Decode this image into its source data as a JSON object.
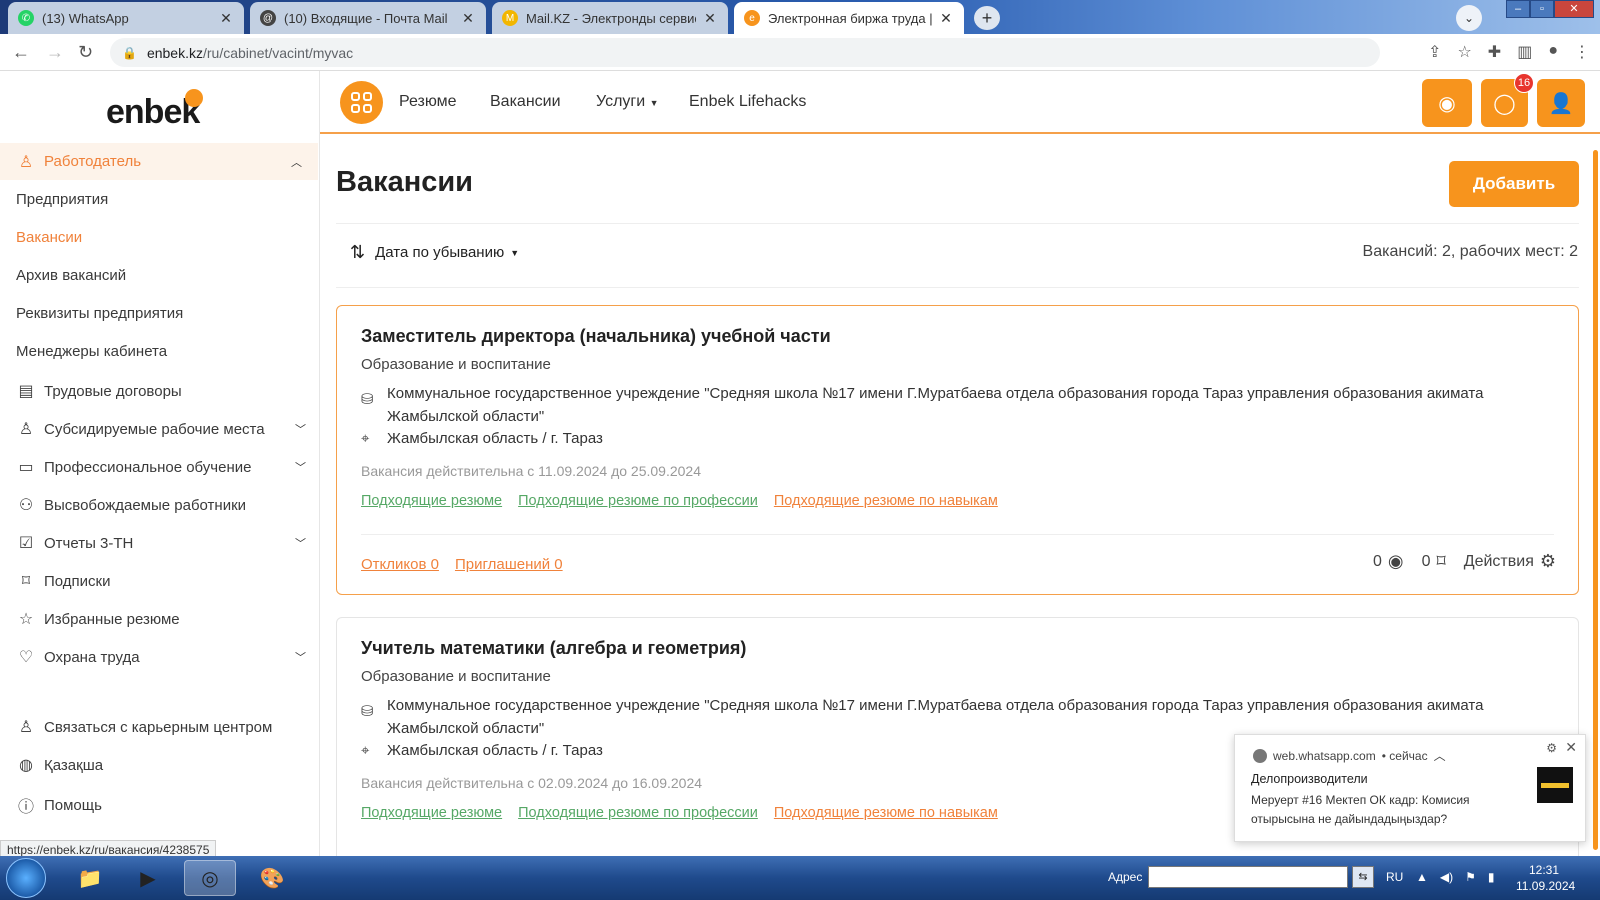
{
  "browser": {
    "tabs": [
      {
        "label": "(13) WhatsApp",
        "active": false,
        "icon": "whatsapp-icon",
        "color": "#25d366"
      },
      {
        "label": "(10) Входящие - Почта Mail",
        "active": false,
        "icon": "mail-icon",
        "color": "#444444"
      },
      {
        "label": "Mail.KZ - Электронды сервиске",
        "active": false,
        "icon": "mailkz-icon",
        "color": "#f2b600"
      },
      {
        "label": "Электронная биржа труда | Вак",
        "active": true,
        "icon": "enbek-icon",
        "color": "#f7941d"
      }
    ],
    "url_domain": "enbek.kz",
    "url_path": "/ru/cabinet/vacint/myvac",
    "status_url": "https://enbek.kz/ru/вакансия/4238575"
  },
  "logo_text": "enbek",
  "sidebar": {
    "section_label": "Работодатель",
    "items": [
      {
        "label": "Предприятия",
        "icon": "",
        "active": false,
        "chevron": false
      },
      {
        "label": "Вакансии",
        "icon": "",
        "active": true,
        "chevron": false
      },
      {
        "label": "Архив вакансий",
        "icon": "",
        "active": false,
        "chevron": false
      },
      {
        "label": "Реквизиты предприятия",
        "icon": "",
        "active": false,
        "chevron": false
      },
      {
        "label": "Менеджеры кабинета",
        "icon": "",
        "active": false,
        "chevron": false
      },
      {
        "label": "Трудовые договоры",
        "icon": "document-icon",
        "active": false,
        "chevron": false
      },
      {
        "label": "Субсидируемые рабочие места",
        "icon": "user-settings-icon",
        "active": false,
        "chevron": true
      },
      {
        "label": "Профессиональное обучение",
        "icon": "book-icon",
        "active": false,
        "chevron": true
      },
      {
        "label": "Высвобождаемые работники",
        "icon": "users-icon",
        "active": false,
        "chevron": false
      },
      {
        "label": "Отчеты 3-ТН",
        "icon": "checkbox-icon",
        "active": false,
        "chevron": true
      },
      {
        "label": "Подписки",
        "icon": "bookmark-icon",
        "active": false,
        "chevron": false
      },
      {
        "label": "Избранные резюме",
        "icon": "star-icon",
        "active": false,
        "chevron": false
      },
      {
        "label": "Охрана труда",
        "icon": "heart-icon",
        "active": false,
        "chevron": true
      }
    ],
    "bottom_items": [
      {
        "label": "Связаться с карьерным центром",
        "icon": "contact-icon"
      },
      {
        "label": "Қазақша",
        "icon": "globe-icon"
      },
      {
        "label": "Помощь",
        "icon": "help-icon"
      }
    ]
  },
  "header": {
    "nav": [
      "Резюме",
      "Вакансии",
      "Услуги",
      "Enbek Lifehacks"
    ],
    "messages_badge": "16"
  },
  "main": {
    "title": "Вакансии",
    "add_button": "Добавить",
    "sort_label": "Дата по убыванию",
    "count_text": "Вакансий: 2, рабочих мест: 2",
    "vacancies": [
      {
        "title": "Заместитель директора (начальника) учебной части",
        "category": "Образование и воспитание",
        "org": "Коммунальное государственное учреждение \"Средняя школа №17 имени Г.Муратбаева отдела образования города Тараз управления образования акимата Жамбылской области\"",
        "location": "Жамбылская область / г. Тараз",
        "validity": "Вакансия действительна с 11.09.2024 до 25.09.2024",
        "link1": "Подходящие резюме",
        "link2": "Подходящие резюме по профессии",
        "link3": "Подходящие резюме по навыкам",
        "responses": "Откликов 0",
        "invitations": "Приглашений 0",
        "views": "0",
        "saved": "0",
        "actions": "Действия"
      },
      {
        "title": "Учитель математики (алгебра и геометрия)",
        "category": "Образование и воспитание",
        "org": "Коммунальное государственное учреждение \"Средняя школа №17 имени Г.Муратбаева отдела образования города Тараз управления образования акимата Жамбылской области\"",
        "location": "Жамбылская область / г. Тараз",
        "validity": "Вакансия действительна с 02.09.2024 до 16.09.2024",
        "link1": "Подходящие резюме",
        "link2": "Подходящие резюме по профессии",
        "link3": "Подходящие резюме по навыкам"
      }
    ]
  },
  "notification": {
    "source": "web.whatsapp.com",
    "time": "• сейчас",
    "title": "Делопроизводители",
    "body": "Меруерт #16 Мектеп ОК кадр: Комисия отырысына не дайындадыңыздар?"
  },
  "taskbar": {
    "address_label": "Адрес",
    "lang": "RU",
    "time": "12:31",
    "date": "11.09.2024"
  },
  "colors": {
    "accent": "#f7941d",
    "link_green": "#56a866",
    "link_orange": "#f0823b"
  }
}
